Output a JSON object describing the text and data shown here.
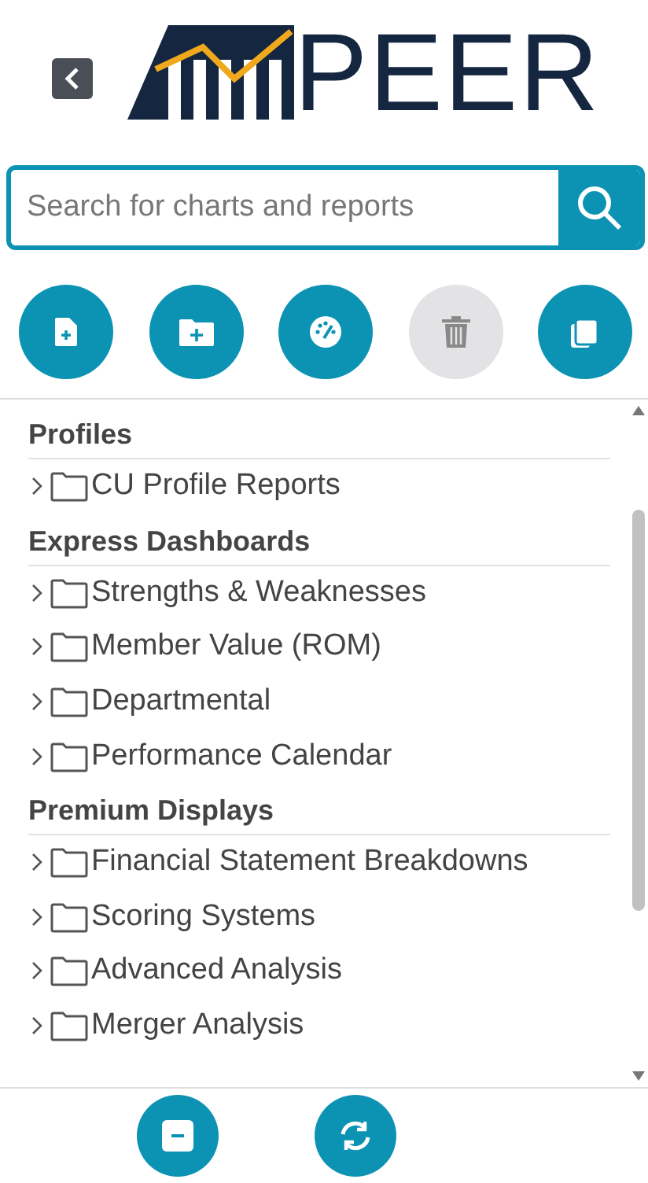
{
  "header": {
    "logo_text": "PEER"
  },
  "search": {
    "placeholder": "Search for charts and reports"
  },
  "actions": [
    {
      "kind": "new-report",
      "disabled": false
    },
    {
      "kind": "new-folder",
      "disabled": false
    },
    {
      "kind": "dashboard",
      "disabled": false
    },
    {
      "kind": "delete",
      "disabled": true
    },
    {
      "kind": "copy",
      "disabled": false
    }
  ],
  "sections": [
    {
      "title": "Profiles",
      "folders": [
        {
          "label": "CU Profile Reports",
          "expanded": false
        }
      ]
    },
    {
      "title": "Express Dashboards",
      "folders": [
        {
          "label": "Strengths & Weaknesses",
          "expanded": false
        },
        {
          "label": "Member Value (ROM)",
          "expanded": false
        },
        {
          "label": "Departmental",
          "expanded": false
        },
        {
          "label": "Performance Calendar",
          "expanded": false
        }
      ]
    },
    {
      "title": "Premium Displays",
      "folders": [
        {
          "label": "Financial Statement Breakdowns",
          "expanded": false
        },
        {
          "label": "Scoring Systems",
          "expanded": false
        },
        {
          "label": "Advanced Analysis",
          "expanded": false
        },
        {
          "label": "Merger Analysis",
          "expanded": false
        }
      ]
    }
  ],
  "footer_actions": [
    {
      "kind": "collapse"
    },
    {
      "kind": "refresh"
    }
  ]
}
